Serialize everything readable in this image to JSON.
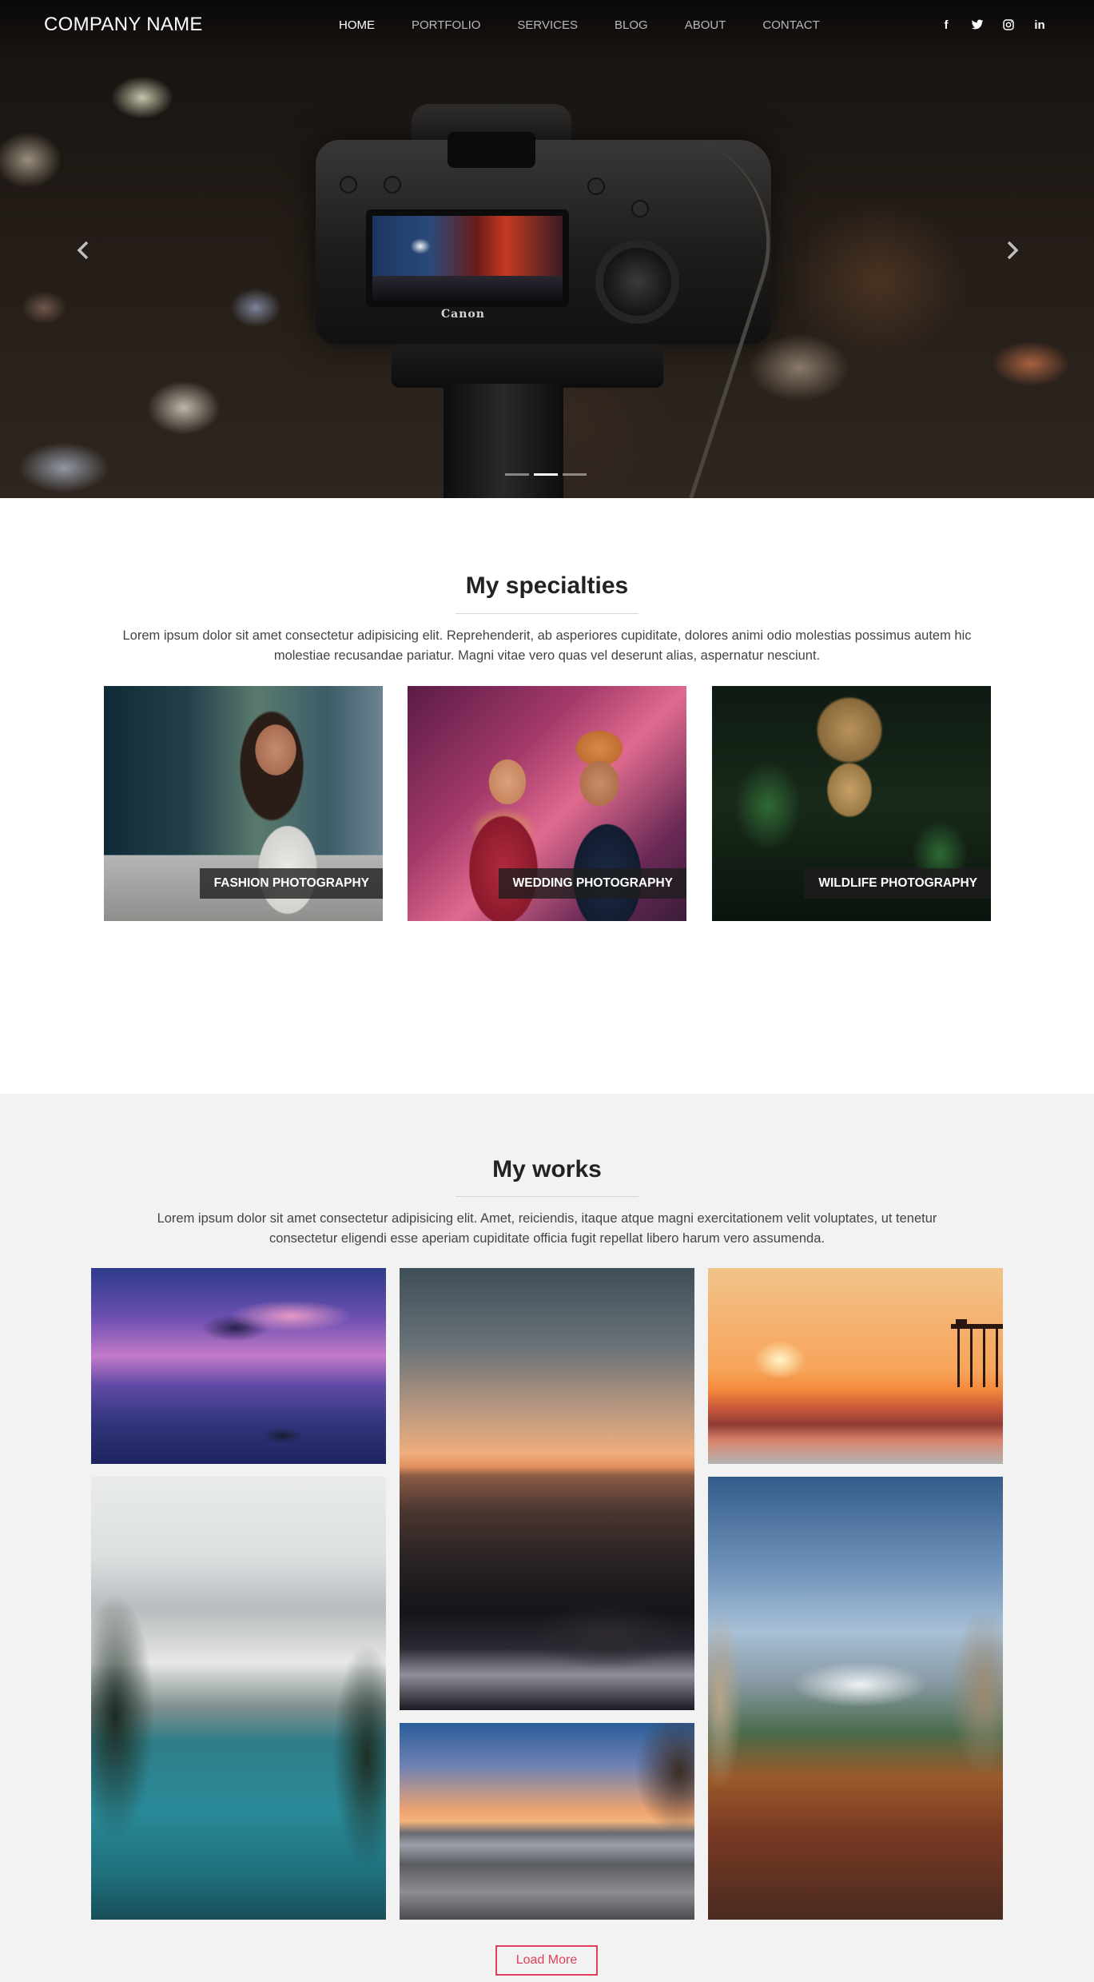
{
  "brand": "COMPANY NAME",
  "nav": {
    "items": [
      {
        "label": "HOME",
        "active": true
      },
      {
        "label": "PORTFOLIO",
        "active": false
      },
      {
        "label": "SERVICES",
        "active": false
      },
      {
        "label": "BLOG",
        "active": false
      },
      {
        "label": "ABOUT",
        "active": false
      },
      {
        "label": "CONTACT",
        "active": false
      }
    ],
    "social": [
      {
        "icon": "facebook-icon",
        "glyph": "f"
      },
      {
        "icon": "twitter-icon"
      },
      {
        "icon": "instagram-icon"
      },
      {
        "icon": "linkedin-icon",
        "glyph": "in"
      }
    ]
  },
  "hero": {
    "camera_brand": "Canon",
    "slides": 3,
    "active_slide": 2
  },
  "specialties": {
    "title": "My specialties",
    "description": "Lorem ipsum dolor sit amet consectetur adipisicing elit. Reprehenderit, ab asperiores cupiditate, dolores animi odio molestias possimus autem hic molestiae recusandae pariatur. Magni vitae vero quas vel deserunt alias, aspernatur nesciunt.",
    "cards": [
      {
        "label": "FASHION PHOTOGRAPHY"
      },
      {
        "label": "WEDDING PHOTOGRAPHY"
      },
      {
        "label": "WILDLIFE PHOTOGRAPHY"
      }
    ]
  },
  "works": {
    "title": "My works",
    "description": "Lorem ipsum dolor sit amet consectetur adipisicing elit. Amet, reiciendis, itaque atque magni exercitationem velit voluptates, ut tenetur consectetur eligendi esse aperiam cupiditate officia fugit repellat libero harum vero assumenda.",
    "load_more": "Load More"
  },
  "colors": {
    "accent": "#e0405a",
    "works_bg": "#f2f2f2"
  }
}
